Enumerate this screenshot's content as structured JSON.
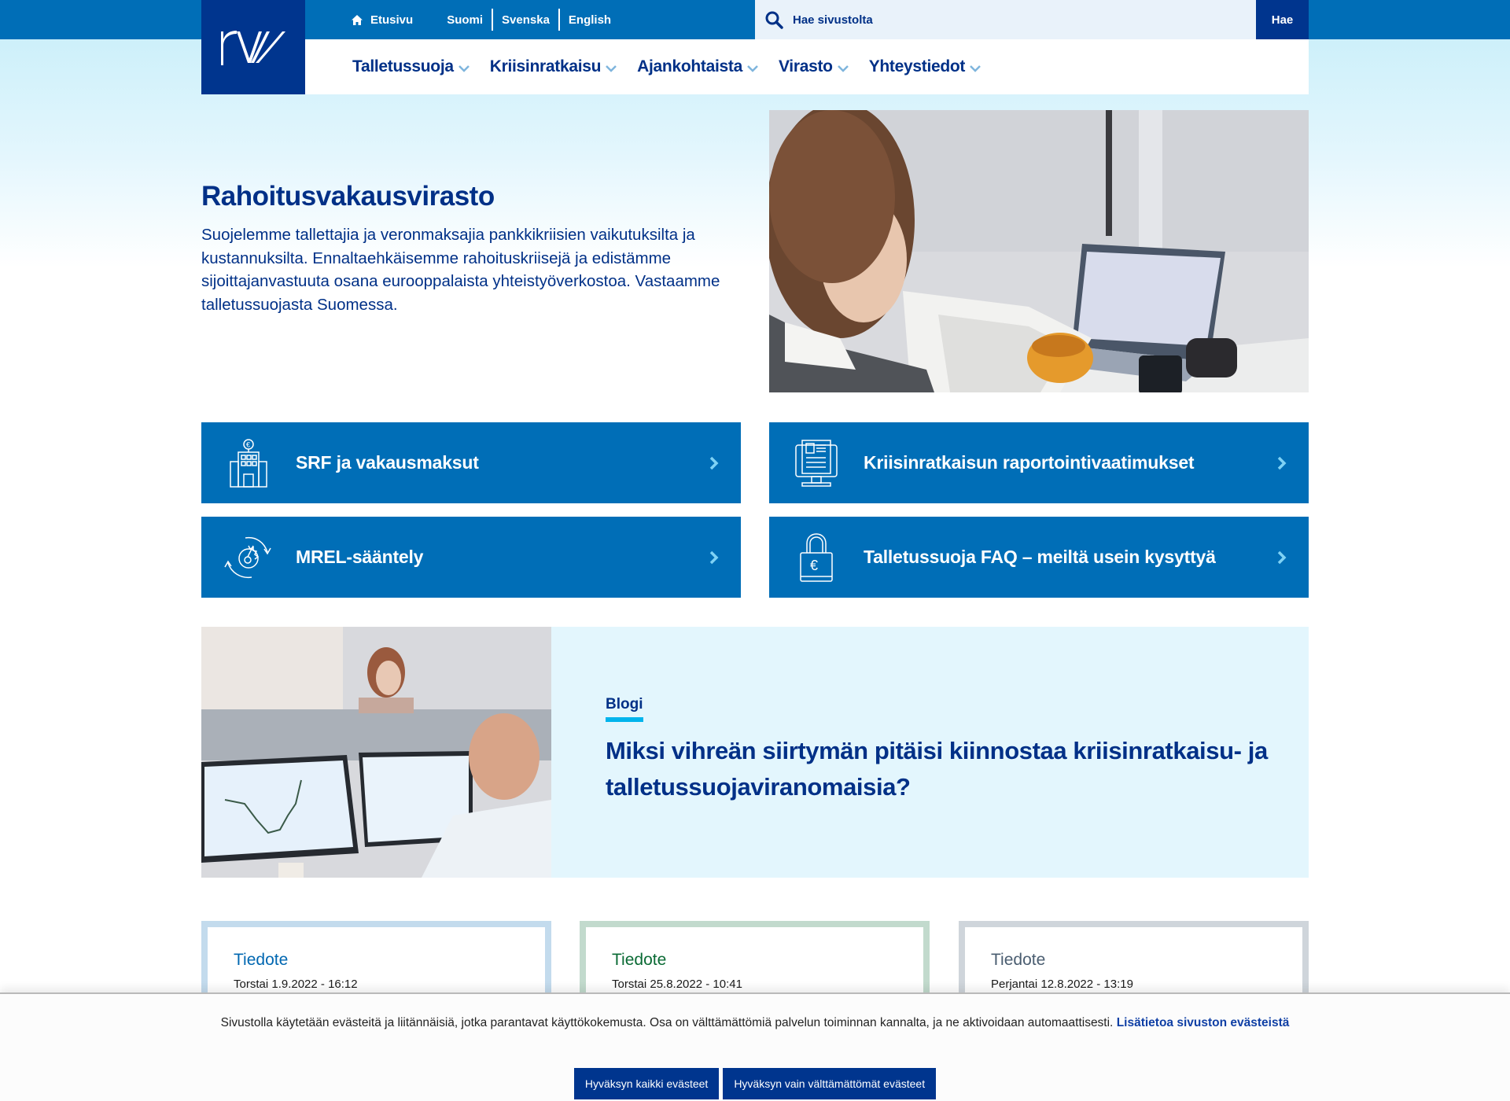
{
  "topbar": {
    "home_label": "Etusivu",
    "home_icon": "home-icon",
    "languages": [
      "Suomi",
      "Svenska",
      "English"
    ],
    "search_placeholder": "Hae sivustolta",
    "search_icon": "search-icon",
    "search_button": "Hae",
    "colors": {
      "bar": "#006eb7",
      "search_bg": "#e9f2fa",
      "button": "#00358e"
    }
  },
  "logo": {
    "text": "rw",
    "icon": "logo-icon"
  },
  "nav": {
    "items": [
      {
        "label": "Talletussuoja"
      },
      {
        "label": "Kriisinratkaisu"
      },
      {
        "label": "Ajankohtaista"
      },
      {
        "label": "Virasto"
      },
      {
        "label": "Yhteystiedot"
      }
    ],
    "chevron_icon": "chevron-down-icon"
  },
  "hero": {
    "title": "Rahoitusvakausvirasto",
    "description": "Suojelemme tallettajia ja veronmaksajia pankkikriisien vaikutuksilta ja kustannuksilta. Ennaltaehkäisemme rahoituskriisejä ja edistämme sijoittajanvastuuta osana eurooppalaista yhteistyöverkostoa. Vastaamme talletussuojasta Suomessa.",
    "image": "woman-reading-report-with-coffee-photo"
  },
  "tiles": [
    {
      "label": "SRF ja vakausmaksut",
      "icon": "bank-building-euro-icon"
    },
    {
      "label": "Kriisinratkaisun raportointivaatimukset",
      "icon": "monitor-document-icon"
    },
    {
      "label": "MREL-sääntely",
      "icon": "gear-cycle-icon"
    },
    {
      "label": "Talletussuoja FAQ – meiltä usein kysyttyä",
      "icon": "padlock-euro-icon"
    }
  ],
  "blog": {
    "tag": "Blogi",
    "title": "Miksi vihreän siirtymän pitäisi kiinnostaa kriisinratkaisu- ja talletussuojaviranomaisia?",
    "image": "office-trading-screens-photo"
  },
  "news": [
    {
      "type": "Tiedote",
      "date": "Torstai 1.9.2022 - 16:12",
      "border": "#c3dbed",
      "type_color": "#0067b1"
    },
    {
      "type": "Tiedote",
      "date": "Torstai 25.8.2022 - 10:41",
      "border": "#c2dacd",
      "type_color": "#0a6a34"
    },
    {
      "type": "Tiedote",
      "date": "Perjantai 12.8.2022 - 13:19",
      "border": "#cfd5db",
      "type_color": "#4a5d70"
    }
  ],
  "cookie": {
    "text": "Sivustolla käytetään evästeitä ja liitännäisiä, jotka parantavat käyttökokemusta. Osa on välttämättömiä palvelun toiminnan kannalta, ja ne aktivoidaan automaattisesti.",
    "link": "Lisätietoa sivuston evästeistä",
    "accept_all": "Hyväksyn kaikki evästeet",
    "accept_necessary": "Hyväksyn vain välttämättömät evästeet"
  }
}
